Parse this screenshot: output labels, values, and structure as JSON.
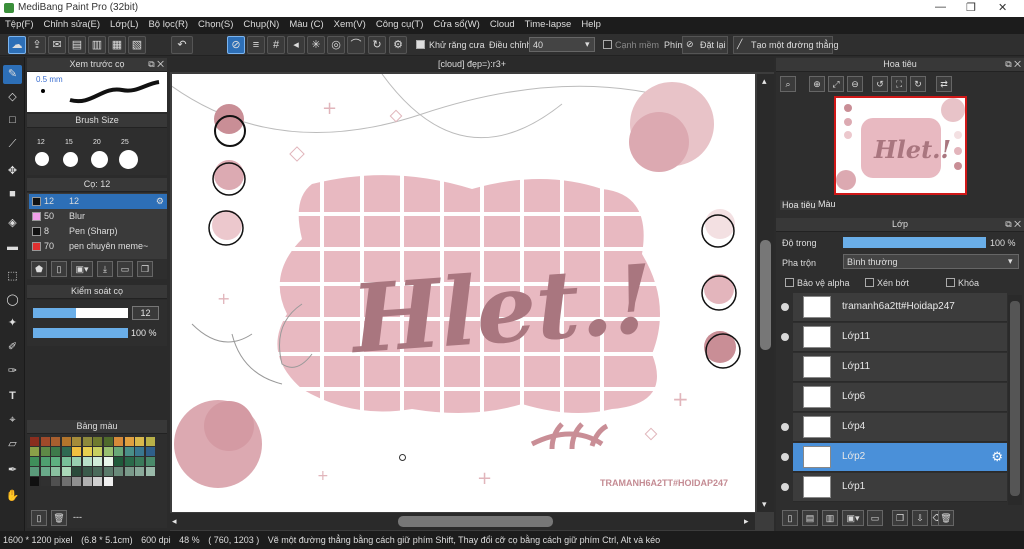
{
  "window": {
    "title": "MediBang Paint Pro (32bit)",
    "controls": [
      "—",
      "❐",
      "✕"
    ]
  },
  "menu": [
    "Tệp(F)",
    "Chỉnh sửa(E)",
    "Lớp(L)",
    "Bộ lọc(R)",
    "Chọn(S)",
    "Chụp(N)",
    "Màu (C)",
    "Xem(V)",
    "Công cụ(T)",
    "Cửa sổ(W)",
    "Cloud",
    "Time-lapse",
    "Help"
  ],
  "toolbar": {
    "antialias_label": "Khử răng cưa",
    "adjust_label": "Điều chỉnh",
    "adjust_value": "40",
    "sharp_label": "Cạnh mềm",
    "key_label": "Phím",
    "reset_label": "Đặt lại",
    "straight_label": "Tạo một đường thẳng"
  },
  "left_panels": {
    "preview_title": "Xem trước cọ",
    "preview_size": "0.5 mm",
    "brush_size_title": "Brush Size",
    "brush_sizes": [
      "12",
      "15",
      "20",
      "25"
    ],
    "brush_list_title": "Cọ: 12",
    "brushes": [
      {
        "size": "12",
        "name": "12",
        "color": "#111111"
      },
      {
        "size": "50",
        "name": "Blur",
        "color": "#f0a0e8"
      },
      {
        "size": "8",
        "name": "Pen (Sharp)",
        "color": "#111111"
      },
      {
        "size": "70",
        "name": "pen chuyên meme~",
        "color": "#e03030"
      }
    ],
    "control_title": "Kiểm soát cọ",
    "control_size": "12",
    "control_opacity": "100 %",
    "control_size_fraction": 0.45,
    "control_opacity_fraction": 1.0,
    "palette_title": "Bảng màu",
    "palette_footer": "---"
  },
  "canvas": {
    "tab_title": "[cloud] đẹp=):r3+",
    "art_text": "Hlet.!",
    "watermark": "TRAMANH6A2TT#HOIDAP247"
  },
  "navigator": {
    "title": "Hoa tiêu",
    "tabs": [
      "Hoa tiêu",
      "Màu"
    ],
    "mini_text": "Hlet.!"
  },
  "layers_panel": {
    "title": "Lớp",
    "opacity_label": "Độ trong",
    "opacity_value": "100 %",
    "opacity_fraction": 1.0,
    "blend_label": "Pha trộn",
    "blend_value": "Bình thường",
    "protect_alpha": "Bảo vệ alpha",
    "clipping": "Xén bớt",
    "lock": "Khóa",
    "layers": [
      {
        "name": "tramanh6a2tt#Hoidap247",
        "visible": true,
        "selected": false
      },
      {
        "name": "Lớp11",
        "visible": true,
        "selected": false
      },
      {
        "name": "Lớp11",
        "visible": false,
        "selected": false
      },
      {
        "name": "Lớp6",
        "visible": false,
        "selected": false
      },
      {
        "name": "Lớp4",
        "visible": true,
        "selected": false
      },
      {
        "name": "Lớp2",
        "visible": true,
        "selected": true
      },
      {
        "name": "Lớp1",
        "visible": true,
        "selected": false
      }
    ]
  },
  "status": {
    "dimensions": "1600 * 1200 pixel",
    "physical": "(6.8 * 5.1cm)",
    "dpi": "600 dpi",
    "zoom": "48 %",
    "cursor": "( 760, 1203 )",
    "hint": "Vẽ một đường thẳng bằng cách giữ phím Shift, Thay đổi cỡ cọ bằng cách giữ phím Ctrl, Alt và kéo"
  }
}
